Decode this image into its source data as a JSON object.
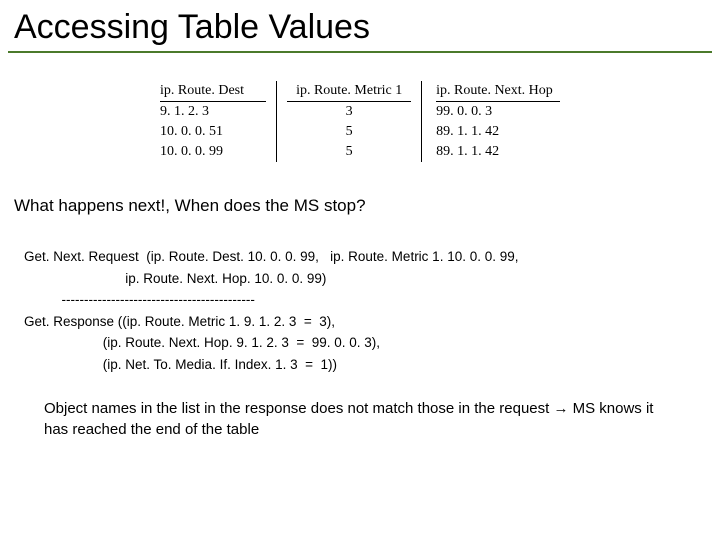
{
  "title": "Accessing Table Values",
  "table": {
    "headers": [
      "ip. Route. Dest",
      "ip. Route. Metric 1",
      "ip. Route. Next. Hop"
    ],
    "rows": [
      [
        "9. 1. 2. 3",
        "3",
        "99. 0. 0. 3"
      ],
      [
        "10. 0. 0. 51",
        "5",
        "89. 1. 1. 42"
      ],
      [
        "10. 0. 0. 99",
        "5",
        "89. 1. 1. 42"
      ]
    ]
  },
  "question": "What happens next!, When does the MS stop?",
  "code": "Get. Next. Request  (ip. Route. Dest. 10. 0. 0. 99,   ip. Route. Metric 1. 10. 0. 0. 99,\n                           ip. Route. Next. Hop. 10. 0. 0. 99)\n          -------------------------------------------\nGet. Response ((ip. Route. Metric 1. 9. 1. 2. 3  =  3),\n                     (ip. Route. Next. Hop. 9. 1. 2. 3  =  99. 0. 0. 3),\n                     (ip. Net. To. Media. If. Index. 1. 3  =  1))",
  "note": "Object names in the list in the response does not match those in the request → MS knows it has reached the end of the table"
}
